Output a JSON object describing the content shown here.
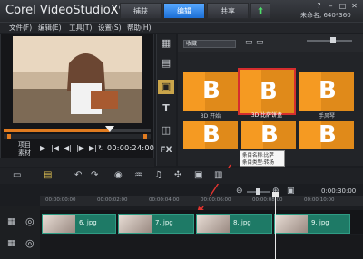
{
  "app": {
    "title": "Corel VideoStudio",
    "version": "X9",
    "tabs": [
      {
        "label": "捕获"
      },
      {
        "label": "编辑"
      },
      {
        "label": "共享"
      },
      {
        "label": "⬆"
      }
    ],
    "project_info": "未命名, 640*360",
    "window_buttons": [
      "?",
      "–",
      "□",
      "✕"
    ]
  },
  "menu": {
    "items": [
      {
        "label": "文件(F)"
      },
      {
        "label": "编辑(E)"
      },
      {
        "label": "工具(T)"
      },
      {
        "label": "设置(S)"
      },
      {
        "label": "帮助(H)"
      }
    ]
  },
  "preview": {
    "mode_project": "项目",
    "mode_clip": "素材",
    "timecode": "00:00:24:00",
    "scrub_progress": 0.72
  },
  "library": {
    "folder_select": "收藏",
    "tools": [
      "film-icon",
      "media-icon",
      "title-icon",
      "graphics-icon",
      "fx-icon"
    ],
    "thumbnails": [
      {
        "caption": "3D 开始"
      },
      {
        "caption": "3D 比萨饼盒"
      },
      {
        "caption": "手风琴"
      },
      {
        "caption": ""
      },
      {
        "caption": ""
      },
      {
        "caption": ""
      }
    ],
    "tooltip_line1": "条目名称:比萨",
    "tooltip_line2": "条目类型:转场"
  },
  "timeline": {
    "timecode": "0:00:30:00",
    "ruler_labels": [
      "00:00:00:00",
      "00:00:02:00",
      "00:00:04:00",
      "00:00:06:00",
      "00:00:08:00",
      "00:00:10:00"
    ],
    "clips": [
      {
        "label": "6. jpg"
      },
      {
        "label": "7. jpg"
      },
      {
        "label": "8. jpg"
      },
      {
        "label": "9. jpg"
      }
    ]
  },
  "colors": {
    "accent_tab": "#1c6fd6",
    "transition_orange": "#e08a1a",
    "clip_green": "#1e7a66",
    "selection_red": "#d62e2e"
  }
}
